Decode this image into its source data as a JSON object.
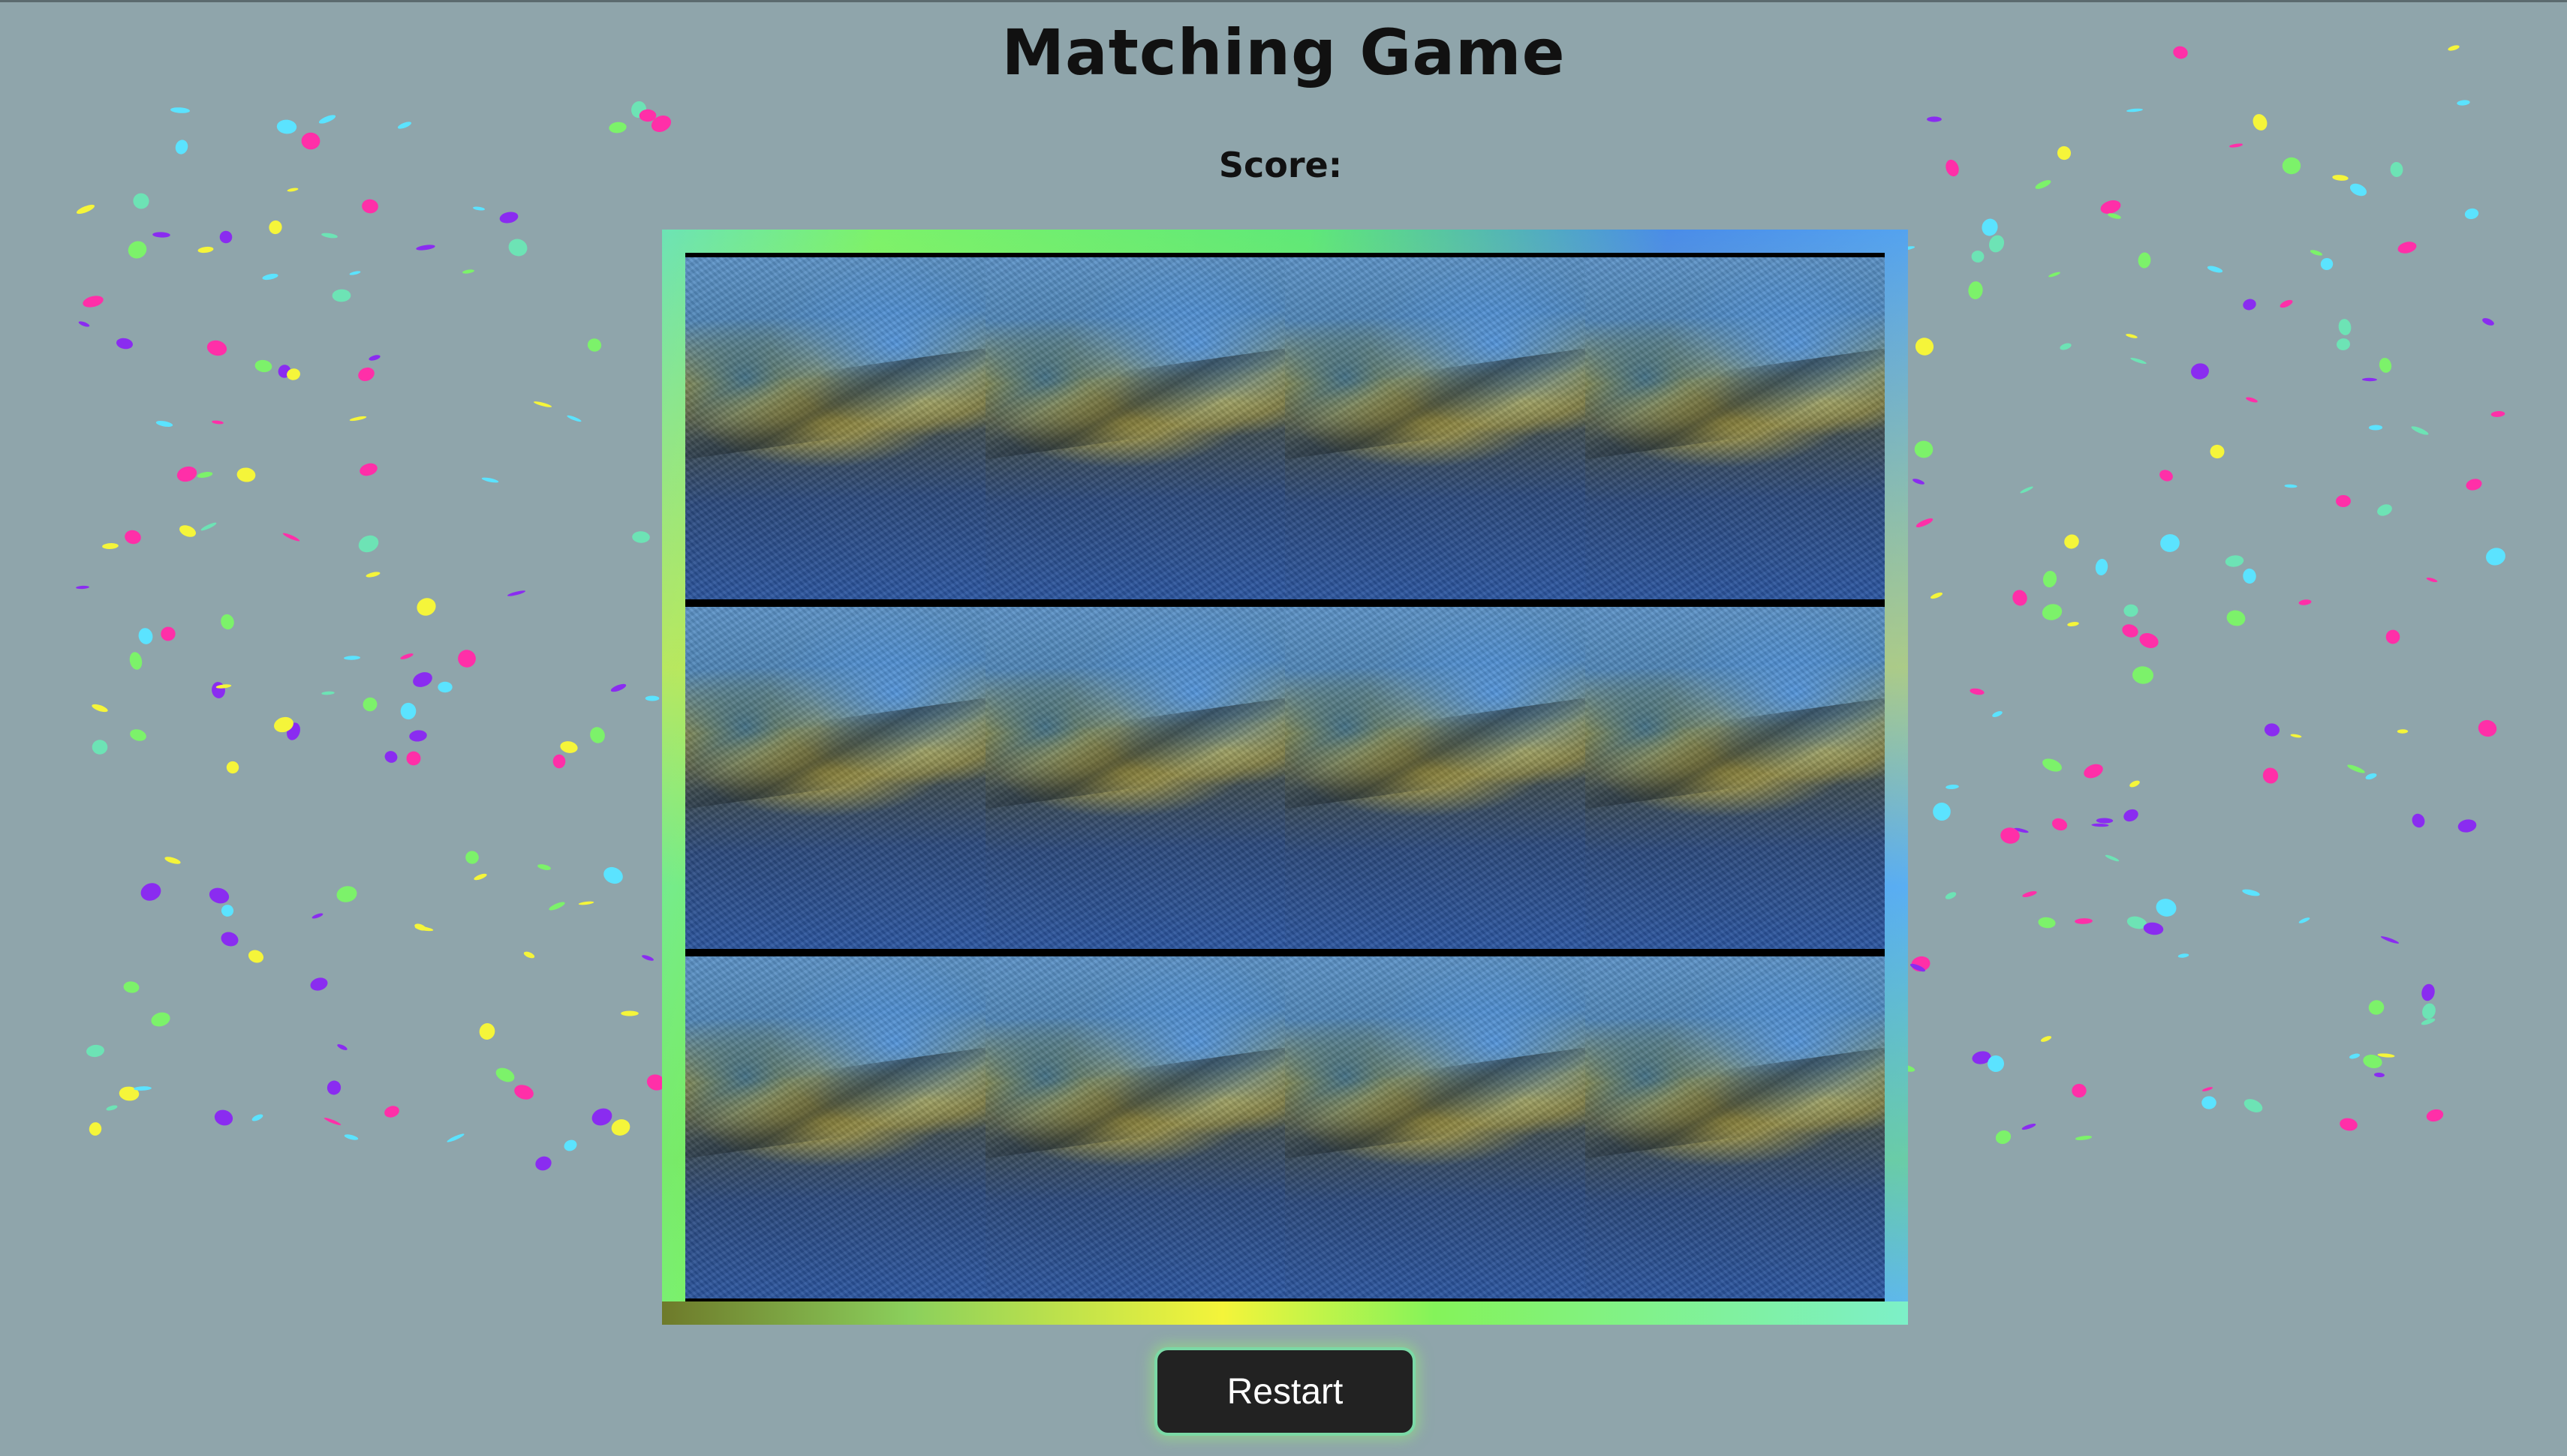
{
  "title": "Matching Game",
  "score": {
    "label": "Score:",
    "value": ""
  },
  "board": {
    "rows": 3,
    "columns": 4,
    "card_state": "face-down"
  },
  "restart": {
    "label": "Restart"
  },
  "colors": {
    "background": "#8fa5ab",
    "confetti": [
      "#ff2fa8",
      "#f5f53a",
      "#8a2cf0",
      "#7cf26a",
      "#5be3ff",
      "#6de3b5"
    ],
    "button_glow": "#7bd9a6"
  }
}
